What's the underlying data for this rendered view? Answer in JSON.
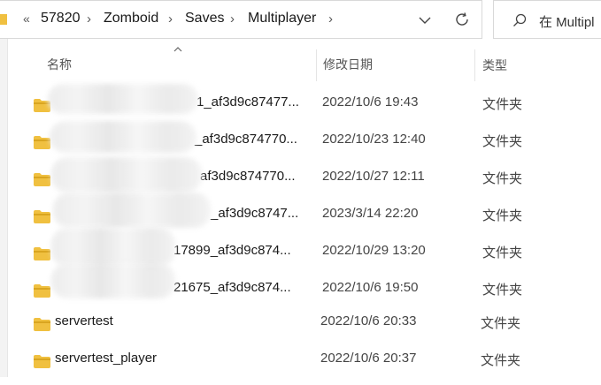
{
  "address": {
    "overflow": "«",
    "crumbs": [
      "57820",
      "Zomboid",
      "Saves",
      "Multiplayer"
    ]
  },
  "search": {
    "placeholder": "在 Multipl"
  },
  "columns": {
    "name": "名称",
    "modified": "修改日期",
    "type": "类型"
  },
  "rows": [
    {
      "name": "1_af3d9c87477...",
      "date": "2022/10/6 19:43",
      "type": "文件夹"
    },
    {
      "name": "_af3d9c874770...",
      "date": "2022/10/23 12:40",
      "type": "文件夹"
    },
    {
      "name": "af3d9c874770...",
      "date": "2022/10/27 12:11",
      "type": "文件夹"
    },
    {
      "name": "_af3d9c8747...",
      "date": "2023/3/14 22:20",
      "type": "文件夹"
    },
    {
      "name": "17899_af3d9c874...",
      "date": "2022/10/29 13:20",
      "type": "文件夹"
    },
    {
      "name": "21675_af3d9c874...",
      "date": "2022/10/6 19:50",
      "type": "文件夹"
    },
    {
      "name": "servertest",
      "date": "2022/10/6 20:33",
      "type": "文件夹"
    },
    {
      "name": "servertest_player",
      "date": "2022/10/6 20:37",
      "type": "文件夹"
    }
  ],
  "colors": {
    "folder": "#f0c040",
    "folder_dark": "#d9a520",
    "border": "#d9d9d9"
  },
  "icons": [
    "folder-icon",
    "chevron-down-icon",
    "refresh-icon",
    "search-icon",
    "sort-up-icon"
  ]
}
